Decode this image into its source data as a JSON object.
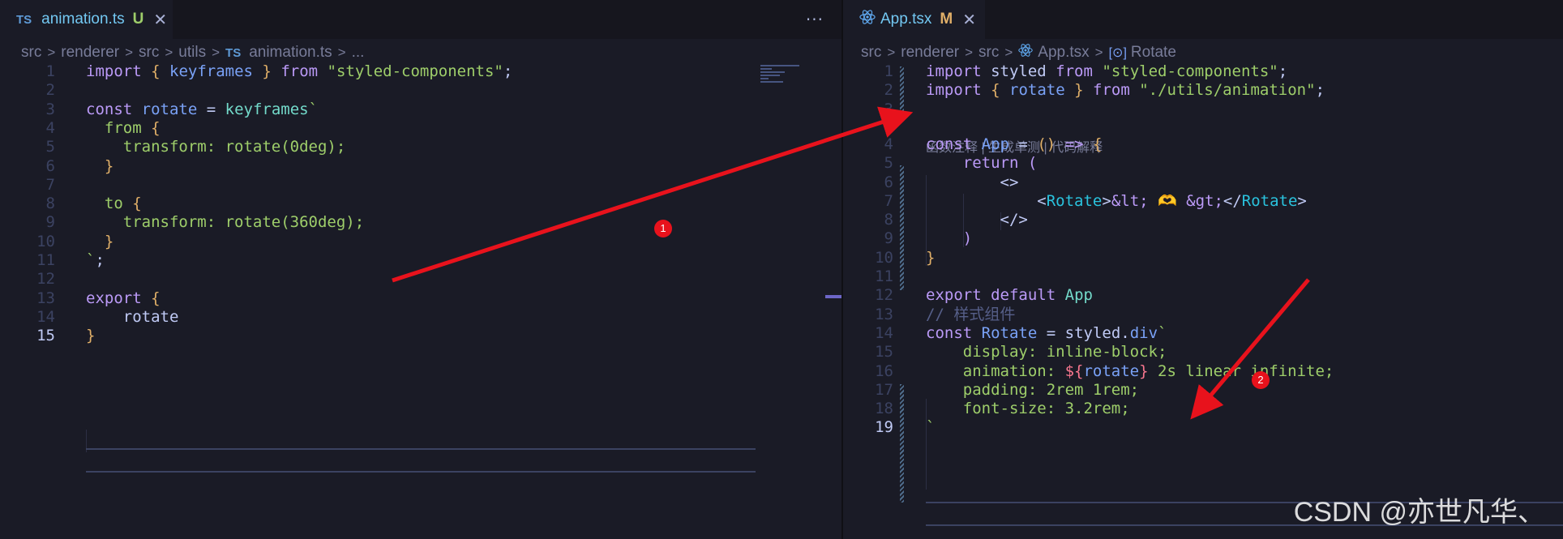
{
  "left_pane": {
    "tab": {
      "badge": "TS",
      "title": "animation.ts",
      "status": "U",
      "status_color": "#9ece6a",
      "close": "✕"
    },
    "more": "···",
    "breadcrumb": [
      "src",
      "renderer",
      "src",
      "utils",
      "TS",
      "animation.ts",
      "..."
    ],
    "lines": [
      {
        "n": "1",
        "tokens": [
          [
            "kw",
            "import"
          ],
          [
            "var",
            " "
          ],
          [
            "br1",
            "{"
          ],
          [
            "var",
            " "
          ],
          [
            "fn",
            "keyframes"
          ],
          [
            "var",
            " "
          ],
          [
            "br1",
            "}"
          ],
          [
            "var",
            " "
          ],
          [
            "kw",
            "from"
          ],
          [
            "var",
            " "
          ],
          [
            "str",
            "\"styled-components\""
          ],
          [
            "var",
            ";"
          ]
        ]
      },
      {
        "n": "2",
        "tokens": []
      },
      {
        "n": "3",
        "tokens": [
          [
            "kw",
            "const"
          ],
          [
            "var",
            " "
          ],
          [
            "fn",
            "rotate"
          ],
          [
            "var",
            " = "
          ],
          [
            "prop",
            "keyframes"
          ],
          [
            "str",
            "`"
          ]
        ]
      },
      {
        "n": "4",
        "tokens": [
          [
            "str",
            "  from "
          ],
          [
            "br1",
            "{"
          ]
        ]
      },
      {
        "n": "5",
        "tokens": [
          [
            "str",
            "    transform: rotate(0deg);"
          ]
        ]
      },
      {
        "n": "6",
        "tokens": [
          [
            "br1",
            "  }"
          ]
        ]
      },
      {
        "n": "7",
        "tokens": []
      },
      {
        "n": "8",
        "tokens": [
          [
            "str",
            "  to "
          ],
          [
            "br1",
            "{"
          ]
        ]
      },
      {
        "n": "9",
        "tokens": [
          [
            "str",
            "    transform: rotate(360deg);"
          ]
        ]
      },
      {
        "n": "10",
        "tokens": [
          [
            "br1",
            "  }"
          ]
        ]
      },
      {
        "n": "11",
        "tokens": [
          [
            "str",
            "`"
          ],
          [
            "var",
            ";"
          ]
        ]
      },
      {
        "n": "12",
        "tokens": []
      },
      {
        "n": "13",
        "tokens": [
          [
            "kw",
            "export"
          ],
          [
            "var",
            " "
          ],
          [
            "br1",
            "{"
          ]
        ]
      },
      {
        "n": "14",
        "tokens": [
          [
            "var",
            "    rotate"
          ]
        ]
      },
      {
        "n": "15",
        "tokens": [
          [
            "br1",
            "}"
          ]
        ],
        "active": true
      }
    ]
  },
  "right_pane": {
    "tab": {
      "title": "App.tsx",
      "status": "M",
      "status_color": "#e0af68",
      "close": "✕"
    },
    "breadcrumb": [
      "src",
      "renderer",
      "src",
      "App.tsx",
      "Rotate"
    ],
    "codelens": "函数注释 | 生成单测 | 代码解释",
    "lines": [
      {
        "n": "1",
        "tokens": [
          [
            "kw",
            "import"
          ],
          [
            "var",
            " styled "
          ],
          [
            "kw",
            "from"
          ],
          [
            "var",
            " "
          ],
          [
            "str",
            "\"styled-components\""
          ],
          [
            "var",
            ";"
          ]
        ]
      },
      {
        "n": "2",
        "tokens": [
          [
            "kw",
            "import"
          ],
          [
            "var",
            " "
          ],
          [
            "br1",
            "{"
          ],
          [
            "var",
            " "
          ],
          [
            "fn",
            "rotate"
          ],
          [
            "var",
            " "
          ],
          [
            "br1",
            "}"
          ],
          [
            "var",
            " "
          ],
          [
            "kw",
            "from"
          ],
          [
            "var",
            " "
          ],
          [
            "str",
            "\"./utils/animation\""
          ],
          [
            "var",
            ";"
          ]
        ]
      },
      {
        "n": "3",
        "tokens": []
      },
      {
        "n": "4",
        "tokens": [
          [
            "kw",
            "const"
          ],
          [
            "var",
            " "
          ],
          [
            "fn",
            "App"
          ],
          [
            "var",
            " = "
          ],
          [
            "br1",
            "()"
          ],
          [
            "var",
            " "
          ],
          [
            "kw",
            "=>"
          ],
          [
            "var",
            " "
          ],
          [
            "br1",
            "{"
          ]
        ]
      },
      {
        "n": "5",
        "tokens": [
          [
            "var",
            "    "
          ],
          [
            "kw",
            "return"
          ],
          [
            "var",
            " "
          ],
          [
            "br2",
            "("
          ]
        ]
      },
      {
        "n": "6",
        "tokens": [
          [
            "var",
            "        "
          ],
          [
            "var",
            "<>"
          ]
        ]
      },
      {
        "n": "7",
        "tokens": [
          [
            "var",
            "            <"
          ],
          [
            "tag",
            "Rotate"
          ],
          [
            "var",
            ">"
          ],
          [
            "ent",
            "&lt;"
          ],
          [
            "var",
            " 🫶 "
          ],
          [
            "ent",
            "&gt;"
          ],
          [
            "var",
            "</"
          ],
          [
            "tag",
            "Rotate"
          ],
          [
            "var",
            ">"
          ]
        ]
      },
      {
        "n": "8",
        "tokens": [
          [
            "var",
            "        </>"
          ]
        ]
      },
      {
        "n": "9",
        "tokens": [
          [
            "var",
            "    "
          ],
          [
            "br2",
            ")"
          ]
        ]
      },
      {
        "n": "10",
        "tokens": [
          [
            "br1",
            "}"
          ]
        ]
      },
      {
        "n": "11",
        "tokens": []
      },
      {
        "n": "12",
        "tokens": [
          [
            "kw",
            "export"
          ],
          [
            "var",
            " "
          ],
          [
            "kw",
            "default"
          ],
          [
            "var",
            " "
          ],
          [
            "prop",
            "App"
          ]
        ]
      },
      {
        "n": "13",
        "tokens": [
          [
            "cmt",
            "// 样式组件"
          ]
        ]
      },
      {
        "n": "14",
        "tokens": [
          [
            "kw",
            "const"
          ],
          [
            "var",
            " "
          ],
          [
            "fn",
            "Rotate"
          ],
          [
            "var",
            " = "
          ],
          [
            "var",
            "styled."
          ],
          [
            "fn",
            "div"
          ],
          [
            "str",
            "`"
          ]
        ]
      },
      {
        "n": "15",
        "tokens": [
          [
            "str",
            "    display: inline-block;"
          ]
        ]
      },
      {
        "n": "16",
        "tokens": [
          [
            "str",
            "    animation: "
          ],
          [
            "interp",
            "${"
          ],
          [
            "fn",
            "rotate"
          ],
          [
            "interp",
            "}"
          ],
          [
            "str",
            " 2s linear infinite;"
          ]
        ]
      },
      {
        "n": "17",
        "tokens": [
          [
            "str",
            "    padding: 2rem 1rem;"
          ]
        ]
      },
      {
        "n": "18",
        "tokens": [
          [
            "str",
            "    font-size: 3.2rem;"
          ]
        ]
      },
      {
        "n": "19",
        "tokens": [
          [
            "str",
            "`"
          ]
        ],
        "active": true
      }
    ]
  },
  "annotations": {
    "badge_1": "1",
    "badge_2": "2",
    "arrow_color": "#e8121c"
  },
  "watermark": "CSDN @亦世凡华、"
}
